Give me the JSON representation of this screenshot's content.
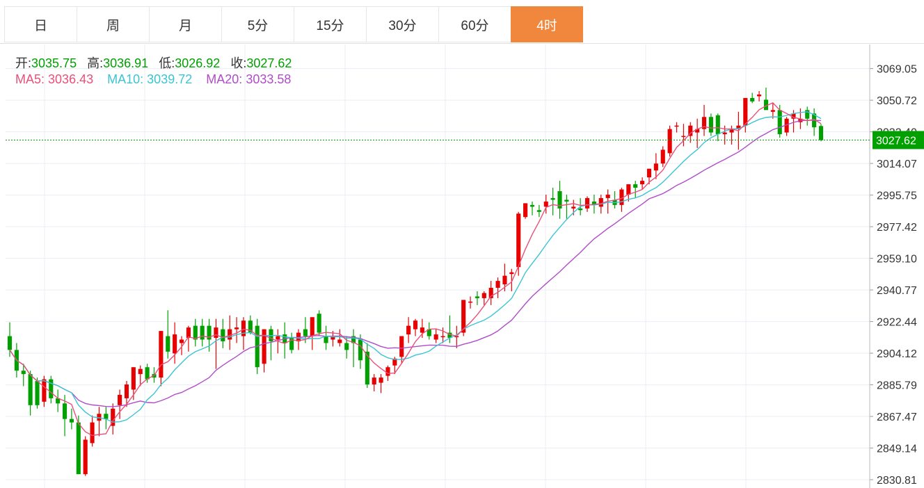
{
  "tabs": [
    {
      "label": "日",
      "active": false
    },
    {
      "label": "周",
      "active": false
    },
    {
      "label": "月",
      "active": false
    },
    {
      "label": "5分",
      "active": false
    },
    {
      "label": "15分",
      "active": false
    },
    {
      "label": "30分",
      "active": false
    },
    {
      "label": "60分",
      "active": false
    },
    {
      "label": "4时",
      "active": true
    }
  ],
  "ohlc": {
    "open_label": "开:",
    "open": "3035.75",
    "high_label": "高:",
    "high": "3036.91",
    "low_label": "低:",
    "low": "3026.92",
    "close_label": "收:",
    "close": "3027.62"
  },
  "ma": {
    "ma5_label": "MA5:",
    "ma5": "3036.43",
    "ma10_label": "MA10:",
    "ma10": "3039.72",
    "ma20_label": "MA20:",
    "ma20": "3033.58"
  },
  "colors": {
    "up": "#e60000",
    "down": "#00a000",
    "ma5": "#e8507a",
    "ma10": "#3cc4d4",
    "ma20": "#b04cc8",
    "accent": "#f0873c",
    "grid": "#e9eef4"
  },
  "chart_data": {
    "type": "candlestick",
    "ylim": [
      2826,
      3083
    ],
    "y_ticks": [
      "3069.05",
      "3050.72",
      "3032.40",
      "3014.07",
      "2995.75",
      "2977.42",
      "2959.10",
      "2940.77",
      "2922.44",
      "2904.12",
      "2885.79",
      "2867.47",
      "2849.14",
      "2830.81"
    ],
    "last_price_label": "3027.62",
    "candles": [
      [
        2914,
        2922,
        2902,
        2906
      ],
      [
        2906,
        2910,
        2890,
        2894
      ],
      [
        2894,
        2898,
        2885,
        2892
      ],
      [
        2892,
        2894,
        2868,
        2874
      ],
      [
        2888,
        2890,
        2872,
        2874
      ],
      [
        2876,
        2891,
        2873,
        2889
      ],
      [
        2889,
        2891,
        2875,
        2878
      ],
      [
        2878,
        2883,
        2870,
        2875
      ],
      [
        2875,
        2880,
        2856,
        2866
      ],
      [
        2866,
        2872,
        2860,
        2864
      ],
      [
        2864,
        2868,
        2834,
        2834
      ],
      [
        2834,
        2856,
        2833,
        2854
      ],
      [
        2852,
        2868,
        2850,
        2864
      ],
      [
        2865,
        2873,
        2856,
        2869
      ],
      [
        2869,
        2873,
        2860,
        2866
      ],
      [
        2862,
        2875,
        2857,
        2872
      ],
      [
        2874,
        2883,
        2866,
        2880
      ],
      [
        2878,
        2888,
        2873,
        2886
      ],
      [
        2883,
        2896,
        2877,
        2896
      ],
      [
        2892,
        2897,
        2885,
        2895
      ],
      [
        2896,
        2898,
        2887,
        2889
      ],
      [
        2892,
        2896,
        2887,
        2890
      ],
      [
        2890,
        2917,
        2885,
        2917
      ],
      [
        2914,
        2929,
        2901,
        2905
      ],
      [
        2904,
        2922,
        2898,
        2915
      ],
      [
        2910,
        2914,
        2903,
        2912
      ],
      [
        2913,
        2920,
        2905,
        2919
      ],
      [
        2920,
        2924,
        2908,
        2912
      ],
      [
        2920,
        2924,
        2908,
        2912
      ],
      [
        2920,
        2924,
        2905,
        2912
      ],
      [
        2913,
        2924,
        2895,
        2919
      ],
      [
        2918,
        2924,
        2907,
        2911
      ],
      [
        2912,
        2926,
        2906,
        2918
      ],
      [
        2918,
        2925,
        2910,
        2919
      ],
      [
        2914,
        2925,
        2906,
        2923
      ],
      [
        2923,
        2926,
        2915,
        2916
      ],
      [
        2920,
        2924,
        2892,
        2896
      ],
      [
        2898,
        2918,
        2893,
        2918
      ],
      [
        2918,
        2920,
        2900,
        2911
      ],
      [
        2912,
        2918,
        2904,
        2914
      ],
      [
        2915,
        2922,
        2901,
        2910
      ],
      [
        2913,
        2916,
        2904,
        2906
      ],
      [
        2911,
        2918,
        2906,
        2916
      ],
      [
        2918,
        2925,
        2910,
        2914
      ],
      [
        2914,
        2925,
        2906,
        2925
      ],
      [
        2927,
        2929,
        2914,
        2916
      ],
      [
        2914,
        2920,
        2906,
        2910
      ],
      [
        2912,
        2917,
        2908,
        2914
      ],
      [
        2910,
        2918,
        2908,
        2912
      ],
      [
        2910,
        2914,
        2901,
        2906
      ],
      [
        2914,
        2918,
        2896,
        2910
      ],
      [
        2912,
        2915,
        2895,
        2900
      ],
      [
        2905,
        2910,
        2884,
        2886
      ],
      [
        2886,
        2892,
        2882,
        2890
      ],
      [
        2887,
        2892,
        2881,
        2890
      ],
      [
        2891,
        2897,
        2888,
        2896
      ],
      [
        2897,
        2902,
        2892,
        2901
      ],
      [
        2902,
        2914,
        2898,
        2914
      ],
      [
        2915,
        2925,
        2910,
        2920
      ],
      [
        2918,
        2924,
        2914,
        2923
      ],
      [
        2916,
        2924,
        2913,
        2919
      ],
      [
        2918,
        2922,
        2912,
        2914
      ],
      [
        2912,
        2918,
        2910,
        2915
      ],
      [
        2914,
        2919,
        2910,
        2914
      ],
      [
        2916,
        2926,
        2910,
        2913
      ],
      [
        2914,
        2920,
        2907,
        2914
      ],
      [
        2916,
        2935,
        2914,
        2935
      ],
      [
        2934,
        2937,
        2930,
        2934
      ],
      [
        2937,
        2940,
        2932,
        2936
      ],
      [
        2936,
        2940,
        2932,
        2939
      ],
      [
        2936,
        2946,
        2932,
        2942
      ],
      [
        2942,
        2948,
        2936,
        2946
      ],
      [
        2944,
        2956,
        2940,
        2949
      ],
      [
        2950,
        2953,
        2940,
        2951
      ],
      [
        2954,
        2986,
        2949,
        2985
      ],
      [
        2983,
        2991,
        2982,
        2991
      ],
      [
        2990,
        2992,
        2984,
        2989
      ],
      [
        2987,
        2990,
        2983,
        2986
      ],
      [
        2989,
        2996,
        2985,
        2992
      ],
      [
        2994,
        3000,
        2984,
        2993
      ],
      [
        2998,
        3004,
        2982,
        2988
      ],
      [
        2993,
        2996,
        2982,
        2992
      ],
      [
        2988,
        2993,
        2984,
        2989
      ],
      [
        2988,
        2994,
        2984,
        2987
      ],
      [
        2988,
        2995,
        2986,
        2994
      ],
      [
        2992,
        2996,
        2985,
        2990
      ],
      [
        2989,
        2996,
        2985,
        2994
      ],
      [
        2994,
        2999,
        2985,
        2996
      ],
      [
        2993,
        2998,
        2988,
        2990
      ],
      [
        2990,
        3000,
        2986,
        2999
      ],
      [
        2996,
        3002,
        2992,
        3002
      ],
      [
        3002,
        3004,
        2994,
        3000
      ],
      [
        3002,
        3006,
        2999,
        3004
      ],
      [
        3006,
        3011,
        3002,
        3011
      ],
      [
        3010,
        3020,
        3005,
        3014
      ],
      [
        3014,
        3024,
        3012,
        3022
      ],
      [
        3020,
        3036,
        3018,
        3034
      ],
      [
        3036,
        3038,
        3032,
        3036
      ],
      [
        3030,
        3037,
        3024,
        3030
      ],
      [
        3030,
        3038,
        3026,
        3036
      ],
      [
        3032,
        3040,
        3023,
        3034
      ],
      [
        3034,
        3048,
        3030,
        3041
      ],
      [
        3041,
        3043,
        3030,
        3032
      ],
      [
        3042,
        3043,
        3027,
        3031
      ],
      [
        3031,
        3036,
        3025,
        3032
      ],
      [
        3032,
        3036,
        3025,
        3034
      ],
      [
        3034,
        3044,
        3022,
        3036
      ],
      [
        3036,
        3050,
        3032,
        3052
      ],
      [
        3052,
        3055,
        3049,
        3050
      ],
      [
        3053,
        3056,
        3050,
        3054
      ],
      [
        3051,
        3058,
        3047,
        3045
      ],
      [
        3044,
        3049,
        3040,
        3045
      ],
      [
        3045,
        3048,
        3029,
        3031
      ],
      [
        3032,
        3041,
        3030,
        3040
      ],
      [
        3040,
        3045,
        3032,
        3043
      ],
      [
        3038,
        3046,
        3034,
        3040
      ],
      [
        3045,
        3047,
        3036,
        3040
      ],
      [
        3043,
        3046,
        3030,
        3035
      ],
      [
        3035.75,
        3036.91,
        3026.92,
        3027.62
      ]
    ]
  }
}
